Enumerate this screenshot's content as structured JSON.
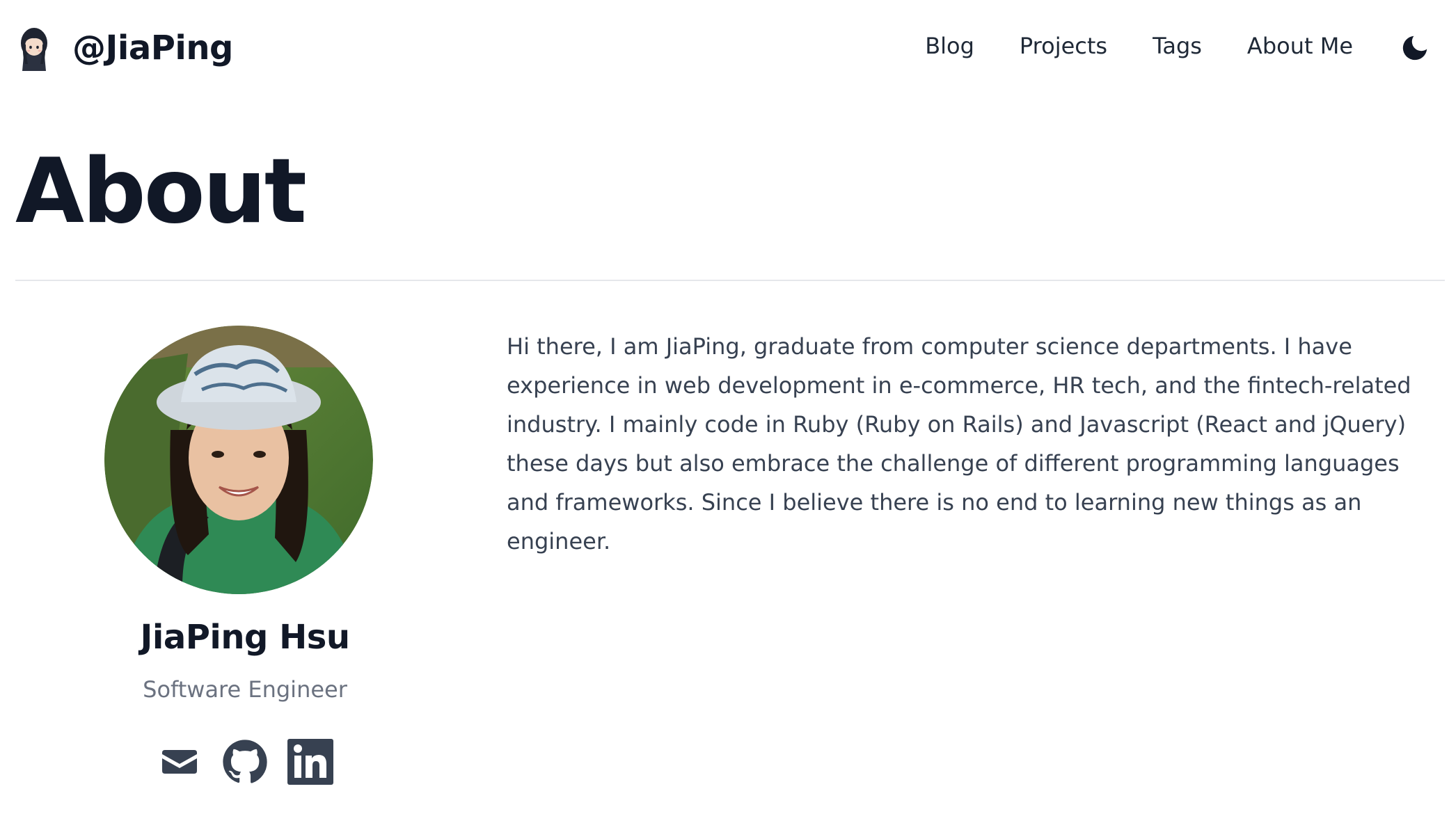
{
  "header": {
    "site_title": "@JiaPing",
    "nav": [
      {
        "label": "Blog"
      },
      {
        "label": "Projects"
      },
      {
        "label": "Tags"
      },
      {
        "label": "About Me"
      }
    ],
    "theme_toggle_icon": "moon-icon"
  },
  "page": {
    "title": "About"
  },
  "profile": {
    "name": "JiaPing Hsu",
    "role": "Software Engineer",
    "avatar_icon": "profile-photo",
    "social": [
      {
        "icon": "mail-icon"
      },
      {
        "icon": "github-icon"
      },
      {
        "icon": "linkedin-icon"
      }
    ]
  },
  "bio": {
    "text": "Hi there, I am JiaPing, graduate from computer science departments. I have experience in web development in e-commerce, HR tech, and the fintech-related industry. I mainly code in Ruby (Ruby on Rails) and Javascript (React and jQuery) these days but also embrace the challenge of different programming languages and frameworks. Since I believe there is no end to learning new things as an engineer."
  },
  "colors": {
    "text_primary": "#111827",
    "text_body": "#374151",
    "text_muted": "#6b7280",
    "divider": "#e5e7eb",
    "icon": "#374151"
  }
}
